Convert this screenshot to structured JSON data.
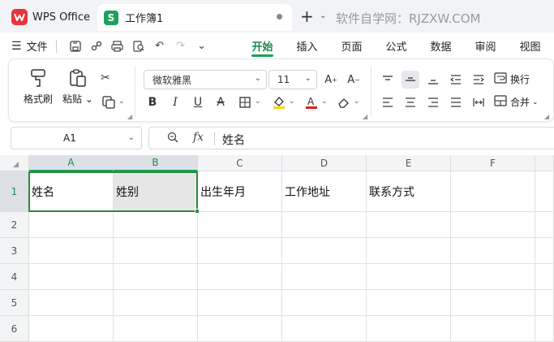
{
  "titlebar": {
    "home_tab_label": "WPS Office",
    "doc_tab_badge": "S",
    "doc_tab_label": "工作簿1",
    "new_tab_symbol": "+",
    "watermark": "软件自学网：RJZXW.COM"
  },
  "menubar": {
    "file_label": "文件",
    "tabs": [
      {
        "label": "开始",
        "active": true
      },
      {
        "label": "插入"
      },
      {
        "label": "页面"
      },
      {
        "label": "公式"
      },
      {
        "label": "数据"
      },
      {
        "label": "审阅"
      },
      {
        "label": "视图"
      }
    ]
  },
  "ribbon": {
    "format_painter_label": "格式刷",
    "paste_label": "粘贴",
    "font_name": "微软雅黑",
    "font_size": "11",
    "wrap_label": "换行",
    "merge_label": "合并",
    "colors": {
      "highlight": "#f5d90a",
      "font_color": "#e02020"
    }
  },
  "formula_bar": {
    "cell_ref": "A1",
    "fx_label": "fx",
    "content": "姓名"
  },
  "grid": {
    "columns": [
      "A",
      "B",
      "C",
      "D",
      "E",
      "F"
    ],
    "rows": [
      "1",
      "2",
      "3",
      "4",
      "5",
      "6"
    ],
    "row1": [
      "姓名",
      "姓别",
      "出生年月",
      "工作地址",
      "联系方式",
      ""
    ],
    "selected_range": "A1:B1"
  },
  "colors": {
    "accent": "#1e9f5b",
    "selection_border": "#2b8a3e"
  }
}
